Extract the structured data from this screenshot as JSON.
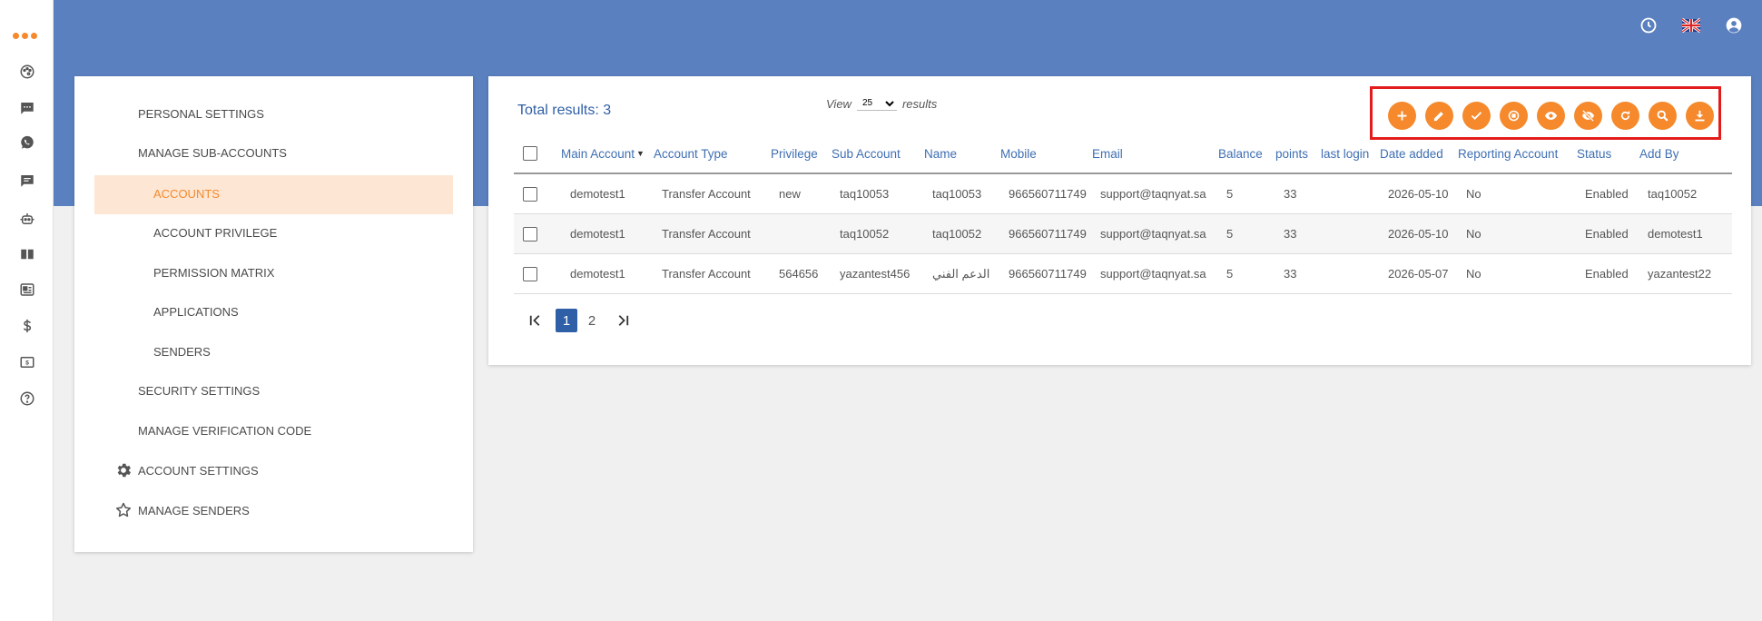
{
  "rail": {
    "items": [
      "palette-icon",
      "chat-icon",
      "whatsapp-icon",
      "message-icon",
      "bot-icon",
      "book-icon",
      "contact-card-icon",
      "dollar-icon",
      "billing-icon",
      "help-icon"
    ]
  },
  "header": {
    "icons": [
      "clock-icon",
      "uk-flag-icon",
      "account-circle-icon"
    ],
    "brand_color": "#5a80bf",
    "accent_color": "#f5892c"
  },
  "settings_menu": {
    "personal_settings": "PERSONAL SETTINGS",
    "manage_sub_accounts": "MANAGE SUB-ACCOUNTS",
    "accounts": "ACCOUNTS",
    "account_privilege": "ACCOUNT PRIVILEGE",
    "permission_matrix": "PERMISSION MATRIX",
    "applications": "APPLICATIONS",
    "senders": "SENDERS",
    "security_settings": "SECURITY SETTINGS",
    "manage_verification_code": "MANAGE VERIFICATION CODE",
    "account_settings": "ACCOUNT SETTINGS",
    "manage_senders": "MANAGE SENDERS"
  },
  "results": {
    "total_label": "Total results: 3",
    "view_label": "View",
    "view_value": "25",
    "view_options": [
      "25"
    ],
    "results_label": "results"
  },
  "toolbar": {
    "buttons": [
      "add-icon",
      "edit-icon",
      "approve-icon",
      "disable-icon",
      "show-icon",
      "hide-icon",
      "refresh-icon",
      "search-icon",
      "download-icon"
    ]
  },
  "table": {
    "headers": {
      "main_account": "Main Account",
      "account_type": "Account Type",
      "privilege": "Privilege",
      "sub_account": "Sub Account",
      "name": "Name",
      "mobile": "Mobile",
      "email": "Email",
      "balance": "Balance",
      "points": "points",
      "last_login": "last login",
      "date_added": "Date added",
      "reporting_account": "Reporting Account",
      "status": "Status",
      "add_by": "Add By"
    },
    "rows": [
      {
        "main_account": "demotest1",
        "account_type": "Transfer Account",
        "privilege": "new",
        "sub_account": "taq10053",
        "name": "taq10053",
        "mobile": "966560711749",
        "email": "support@taqnyat.sa",
        "balance": "5",
        "points": "33",
        "last_login": "",
        "date_added": "2026-05-10",
        "reporting_account": "No",
        "status": "Enabled",
        "add_by": "taq10052"
      },
      {
        "main_account": "demotest1",
        "account_type": "Transfer Account",
        "privilege": "",
        "sub_account": "taq10052",
        "name": "taq10052",
        "mobile": "966560711749",
        "email": "support@taqnyat.sa",
        "balance": "5",
        "points": "33",
        "last_login": "",
        "date_added": "2026-05-10",
        "reporting_account": "No",
        "status": "Enabled",
        "add_by": "demotest1"
      },
      {
        "main_account": "demotest1",
        "account_type": "Transfer Account",
        "privilege": "564656",
        "sub_account": "yazantest456",
        "name": "الدعم الفني",
        "mobile": "966560711749",
        "email": "support@taqnyat.sa",
        "balance": "5",
        "points": "33",
        "last_login": "",
        "date_added": "2026-05-07",
        "reporting_account": "No",
        "status": "Enabled",
        "add_by": "yazantest22"
      }
    ]
  },
  "pagination": {
    "pages": [
      "1",
      "2"
    ],
    "current": "1"
  }
}
